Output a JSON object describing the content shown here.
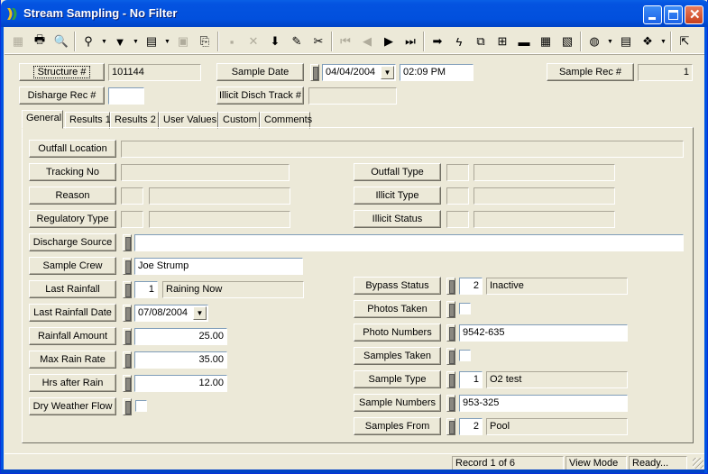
{
  "window": {
    "title": "Stream Sampling - No Filter",
    "minimize_icon": "minimize-icon",
    "maximize_icon": "maximize-icon",
    "close_icon": "close-icon"
  },
  "toolbar": {
    "buttons": [
      {
        "name": "form-view",
        "icon": "▦",
        "enabled": false
      },
      {
        "name": "print",
        "icon": "🖶",
        "enabled": true
      },
      {
        "name": "print-preview",
        "icon": "🔍",
        "enabled": true
      },
      {
        "name": "find",
        "icon": "⚲",
        "enabled": true,
        "dropdown": true
      },
      {
        "name": "filter",
        "icon": "▼",
        "enabled": true,
        "dropdown": true
      },
      {
        "name": "report",
        "icon": "▤",
        "enabled": true,
        "dropdown": true
      },
      {
        "name": "properties",
        "icon": "▣",
        "enabled": false
      },
      {
        "name": "export",
        "icon": "⎘",
        "enabled": true
      },
      {
        "name": "save",
        "icon": "▪",
        "enabled": false
      },
      {
        "name": "delete",
        "icon": "✕",
        "enabled": false
      },
      {
        "name": "add-record",
        "icon": "⬇",
        "enabled": true
      },
      {
        "name": "edit",
        "icon": "✎",
        "enabled": true
      },
      {
        "name": "cut",
        "icon": "✂",
        "enabled": true
      },
      {
        "name": "first-record",
        "icon": "⏮",
        "enabled": false
      },
      {
        "name": "previous-record",
        "icon": "◀",
        "enabled": false
      },
      {
        "name": "next-record",
        "icon": "▶",
        "enabled": true
      },
      {
        "name": "last-record",
        "icon": "⏭",
        "enabled": true
      },
      {
        "name": "goto",
        "icon": "➡",
        "enabled": true
      },
      {
        "name": "lightning",
        "icon": "ϟ",
        "enabled": true
      },
      {
        "name": "related",
        "icon": "⧉",
        "enabled": true
      },
      {
        "name": "link",
        "icon": "⊞",
        "enabled": true
      },
      {
        "name": "equipment",
        "icon": "▬",
        "enabled": true
      },
      {
        "name": "calendar",
        "icon": "▦",
        "enabled": true
      },
      {
        "name": "map",
        "icon": "▧",
        "enabled": true
      },
      {
        "name": "web",
        "icon": "◍",
        "enabled": true,
        "dropdown": true
      },
      {
        "name": "spreadsheet",
        "icon": "▤",
        "enabled": true
      },
      {
        "name": "help-book",
        "icon": "❖",
        "enabled": true,
        "dropdown": true
      },
      {
        "name": "exit",
        "icon": "⇱",
        "enabled": true
      }
    ]
  },
  "header": {
    "structure_label": "Structure #",
    "structure_value": "101144",
    "discharge_rec_label": "Disharge Rec #",
    "discharge_rec_value": "",
    "sample_date_label": "Sample Date",
    "sample_date_value": "04/04/2004",
    "sample_time_value": "02:09 PM",
    "illicit_track_label": "Illicit Disch Track #",
    "illicit_track_value": "",
    "sample_rec_label": "Sample Rec #",
    "sample_rec_value": "1"
  },
  "tabs": [
    "General",
    "Results 1",
    "Results 2",
    "User Values",
    "Custom",
    "Comments"
  ],
  "active_tab": "General",
  "general": {
    "outfall_location": {
      "label": "Outfall Location",
      "value": ""
    },
    "tracking_no": {
      "label": "Tracking No",
      "value": ""
    },
    "reason": {
      "label": "Reason",
      "code": "",
      "desc": ""
    },
    "regulatory_type": {
      "label": "Regulatory Type",
      "code": "",
      "desc": ""
    },
    "outfall_type": {
      "label": "Outfall Type",
      "code": "",
      "desc": ""
    },
    "illicit_type": {
      "label": "Illicit Type",
      "code": "",
      "desc": ""
    },
    "illicit_status": {
      "label": "Illicit Status",
      "code": "",
      "desc": ""
    },
    "discharge_source": {
      "label": "Discharge Source",
      "value": ""
    },
    "sample_crew": {
      "label": "Sample Crew",
      "value": "Joe Strump"
    },
    "last_rainfall": {
      "label": "Last Rainfall",
      "code": "1",
      "desc": "Raining Now"
    },
    "last_rainfall_date": {
      "label": "Last Rainfall Date",
      "value": "07/08/2004"
    },
    "rainfall_amount": {
      "label": "Rainfall Amount",
      "value": "25.00"
    },
    "max_rain_rate": {
      "label": "Max Rain Rate",
      "value": "35.00"
    },
    "hrs_after_rain": {
      "label": "Hrs after Rain",
      "value": "12.00"
    },
    "dry_weather_flow": {
      "label": "Dry Weather Flow",
      "checked": false
    },
    "bypass_status": {
      "label": "Bypass Status",
      "code": "2",
      "desc": "Inactive"
    },
    "photos_taken": {
      "label": "Photos Taken",
      "checked": false
    },
    "photo_numbers": {
      "label": "Photo Numbers",
      "value": "9542-635"
    },
    "samples_taken": {
      "label": "Samples Taken",
      "checked": false
    },
    "sample_type": {
      "label": "Sample Type",
      "code": "1",
      "desc": "O2 test"
    },
    "sample_numbers": {
      "label": "Sample Numbers",
      "value": "953-325"
    },
    "samples_from": {
      "label": "Samples From",
      "code": "2",
      "desc": "Pool"
    }
  },
  "statusbar": {
    "record": "Record 1 of 6",
    "mode": "View Mode",
    "state": "Ready..."
  }
}
